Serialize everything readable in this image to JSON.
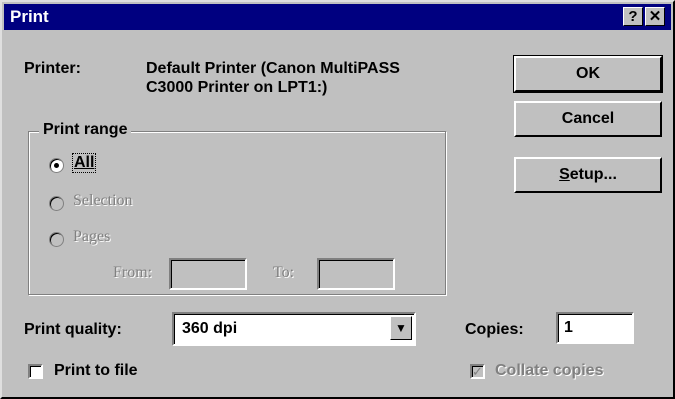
{
  "window": {
    "title": "Print",
    "help_label": "?",
    "close_label": "✕"
  },
  "printer": {
    "label": "Printer:",
    "line1": "Default Printer (Canon MultiPASS",
    "line2": "C3000 Printer on LPT1:)"
  },
  "buttons": {
    "ok": "OK",
    "cancel": "Cancel",
    "setup": "Setup..."
  },
  "print_range": {
    "title": "Print range",
    "options": {
      "all": "All",
      "selection": "Selection",
      "pages": "Pages"
    },
    "selected": "all",
    "from_label": "From:",
    "to_label": "To:"
  },
  "quality": {
    "label": "Print quality:",
    "value": "360 dpi"
  },
  "copies": {
    "label": "Copies:",
    "value": "1"
  },
  "print_to_file": {
    "label": "Print to file",
    "checked": false
  },
  "collate": {
    "label": "Collate copies",
    "checked": true,
    "enabled": false
  },
  "colors": {
    "title_bar": "#000080",
    "face": "#c0c0c0",
    "disabled_text": "#808080"
  }
}
